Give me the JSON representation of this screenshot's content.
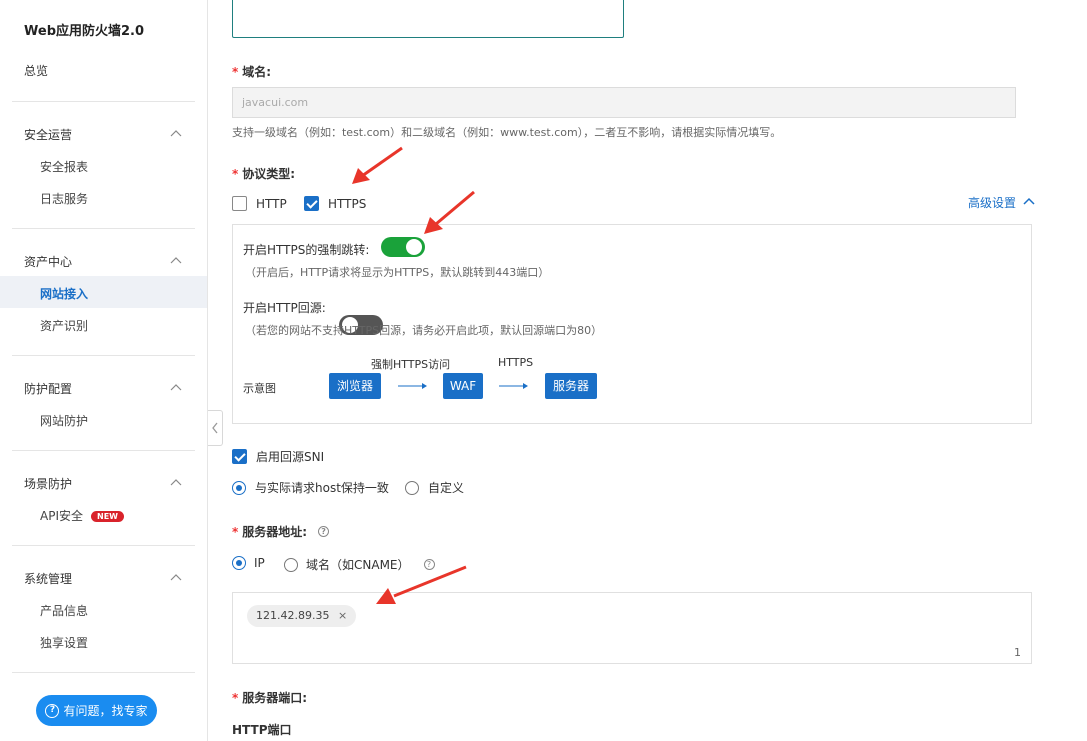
{
  "sidebar": {
    "title": "Web应用防火墙2.0",
    "overview": "总览",
    "groups": [
      {
        "label": "安全运营",
        "items": [
          "安全报表",
          "日志服务"
        ]
      },
      {
        "label": "资产中心",
        "items": [
          "网站接入",
          "资产识别"
        ]
      },
      {
        "label": "防护配置",
        "items": [
          "网站防护"
        ]
      },
      {
        "label": "场景防护",
        "items": [
          "API安全"
        ]
      },
      {
        "label": "系统管理",
        "items": [
          "产品信息",
          "独享设置"
        ]
      }
    ],
    "active_item": "网站接入",
    "new_badge": "NEW",
    "help_button": "有问题，找专家",
    "help_icon": "?"
  },
  "form": {
    "domain": {
      "required": "*",
      "label": "域名:",
      "value": "javacui.com",
      "hint": "支持一级域名（例如：test.com）和二级域名（例如：www.test.com），二者互不影响，请根据实际情况填写。"
    },
    "protocol": {
      "required": "*",
      "label": "协议类型:",
      "http_label": "HTTP",
      "https_label": "HTTPS",
      "http_checked": false,
      "https_checked": true,
      "advanced": "高级设置"
    },
    "panel": {
      "force_https_label": "开启HTTPS的强制跳转:",
      "force_https_on": true,
      "force_https_hint": "（开启后，HTTP请求将显示为HTTPS，默认跳转到443端口）",
      "http_origin_label": "开启HTTP回源:",
      "http_origin_on": false,
      "http_origin_hint": "（若您的网站不支持HTTPS回源，请务必开启此项，默认回源端口为80）",
      "diagram_label": "示意图",
      "diagram_top_left": "强制HTTPS访问",
      "diagram_top_right": "HTTPS",
      "diagram_nodes": [
        "浏览器",
        "WAF",
        "服务器"
      ]
    },
    "sni": {
      "label": "启用回源SNI",
      "checked": true,
      "option_same": "与实际请求host保持一致",
      "option_custom": "自定义",
      "selected": "与实际请求host保持一致"
    },
    "server_address": {
      "required": "*",
      "label": "服务器地址:",
      "help": "?",
      "option_ip": "IP",
      "option_domain": "域名（如CNAME）",
      "selected": "IP",
      "tags": [
        "121.42.89.35"
      ],
      "tag_close": "×",
      "count": "1"
    },
    "server_port": {
      "required": "*",
      "label": "服务器端口:",
      "http_port_label": "HTTP端口"
    }
  },
  "colors": {
    "accent": "#1a6fc7",
    "toggle_on": "#1aa23a",
    "annotation_arrow": "#e8352a"
  }
}
